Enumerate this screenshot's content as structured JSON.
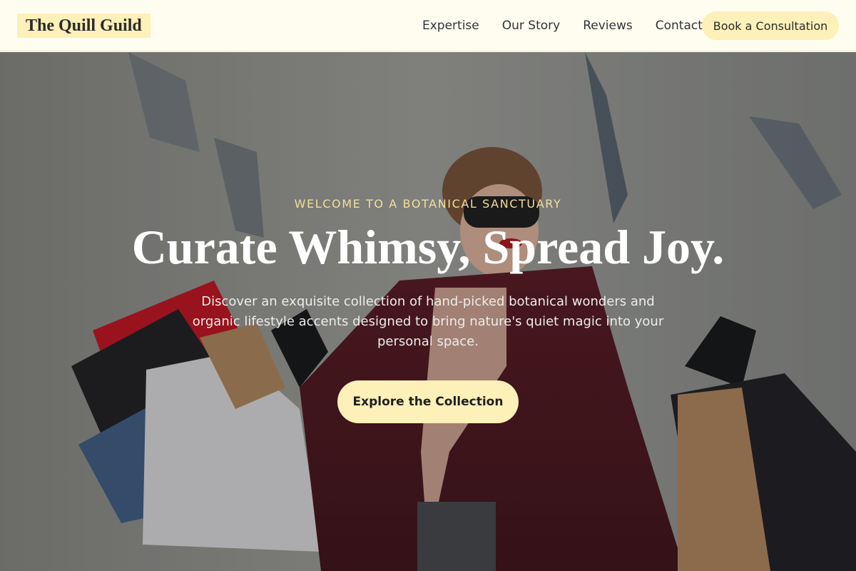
{
  "header": {
    "logo": "The Quill Guild",
    "nav": [
      "Expertise",
      "Our Story",
      "Reviews",
      "Contact"
    ],
    "cta": "Book a Consultation"
  },
  "hero": {
    "eyebrow": "WELCOME TO A BOTANICAL SANCTUARY",
    "headline": "Curate Whimsy, Spread Joy.",
    "subtext": "Discover an exquisite collection of hand-picked botanical wonders and organic lifestyle accents designed to bring nature's quiet magic into your personal space.",
    "cta": "Explore the Collection",
    "image": "woman-with-shopping-bags-photo"
  },
  "colors": {
    "accent": "#fdf0b8",
    "header_bg": "#fffdf0",
    "eyebrow": "#f3de9c",
    "coat": "#6b1a25"
  }
}
